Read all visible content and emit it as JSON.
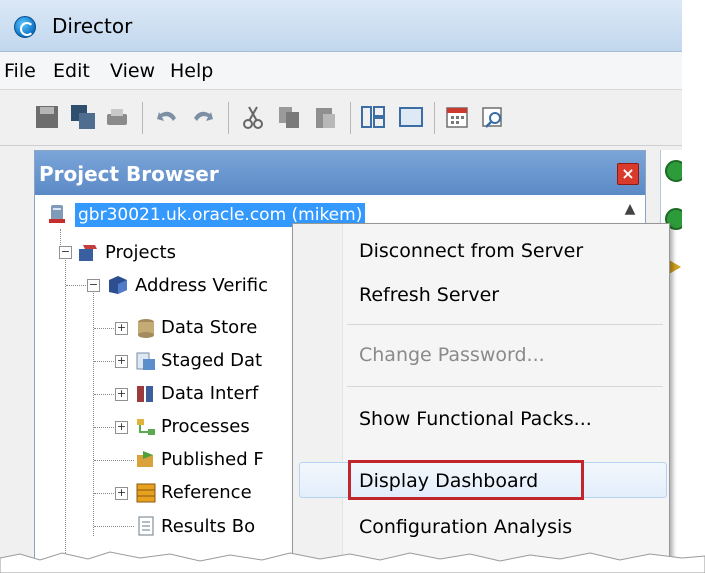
{
  "window": {
    "title": "Director",
    "app_icon": "director-logo-icon"
  },
  "menubar": {
    "items": [
      "File",
      "Edit",
      "View",
      "Help"
    ]
  },
  "toolbar": {
    "icons": [
      "save-icon",
      "save-all-icon",
      "print-icon",
      "undo-icon",
      "redo-icon",
      "cut-icon",
      "copy-icon",
      "paste-icon",
      "layout-icon",
      "maximize-icon",
      "calendar-icon",
      "find-icon"
    ]
  },
  "project_browser": {
    "title": "Project Browser",
    "server": "gbr30021.uk.oracle.com (mikem)",
    "tree": {
      "projects_label": "Projects",
      "project_label": "Address Verific",
      "children": [
        {
          "label": "Data Store",
          "icon": "data-store-icon",
          "expandable": true
        },
        {
          "label": "Staged Dat",
          "icon": "staged-data-icon",
          "expandable": true
        },
        {
          "label": "Data Interf",
          "icon": "data-interface-icon",
          "expandable": true
        },
        {
          "label": "Processes",
          "icon": "processes-icon",
          "expandable": true
        },
        {
          "label": "Published F",
          "icon": "published-icon",
          "expandable": false
        },
        {
          "label": "Reference",
          "icon": "reference-icon",
          "expandable": true
        },
        {
          "label": "Results Bo",
          "icon": "results-book-icon",
          "expandable": false
        }
      ]
    }
  },
  "context_menu": {
    "items": [
      {
        "label": "Disconnect from Server",
        "enabled": true
      },
      {
        "label": "Refresh Server",
        "enabled": true
      },
      {
        "label": "Change Password...",
        "enabled": false
      },
      {
        "label": "Show Functional Packs...",
        "enabled": true
      },
      {
        "label": "Display Dashboard",
        "enabled": true,
        "highlighted": true
      },
      {
        "label": "Configuration Analysis",
        "enabled": true
      }
    ]
  },
  "colors": {
    "selection": "#3399ff",
    "header": "#6b96cf",
    "highlight_box": "#c0262b"
  }
}
